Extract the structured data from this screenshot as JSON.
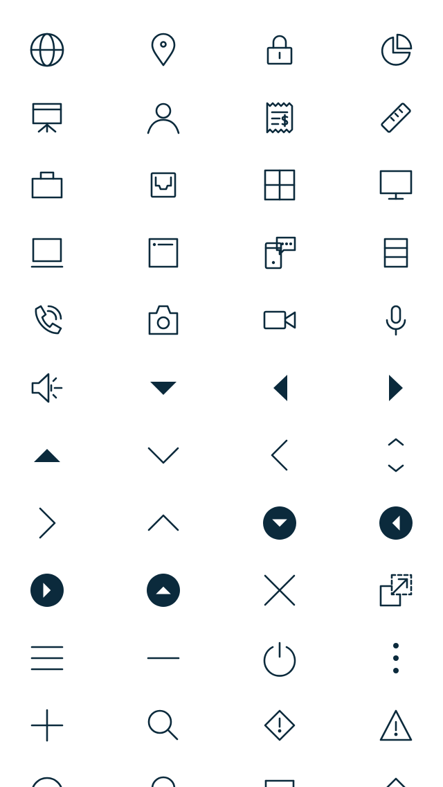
{
  "theme": {
    "icon_color": "#0b2a3c",
    "background": "#ffffff"
  },
  "icons": [
    "globe-icon",
    "location-pin-icon",
    "lock-icon",
    "pie-chart-icon",
    "presentation-icon",
    "user-icon",
    "receipt-icon",
    "ruler-icon",
    "briefcase-icon",
    "inbox-icon",
    "grid-icon",
    "monitor-icon",
    "laptop-icon",
    "browser-window-icon",
    "mobile-chat-icon",
    "server-icon",
    "phone-call-icon",
    "camera-icon",
    "video-camera-icon",
    "microphone-icon",
    "speaker-icon",
    "caret-down-icon",
    "caret-left-icon",
    "caret-right-icon",
    "caret-up-icon",
    "chevron-down-icon",
    "chevron-left-icon",
    "chevron-up-down-icon",
    "chevron-right-icon",
    "chevron-up-icon",
    "circle-caret-down-icon",
    "circle-caret-left-icon",
    "circle-caret-right-icon",
    "circle-caret-up-icon",
    "close-icon",
    "expand-window-icon",
    "menu-icon",
    "minus-icon",
    "power-icon",
    "more-vertical-icon",
    "plus-icon",
    "search-icon",
    "diamond-alert-icon",
    "warning-triangle-icon",
    "circle-partial-icon",
    "pin-partial-icon",
    "rectangle-partial-icon",
    "diamond-partial-icon"
  ]
}
